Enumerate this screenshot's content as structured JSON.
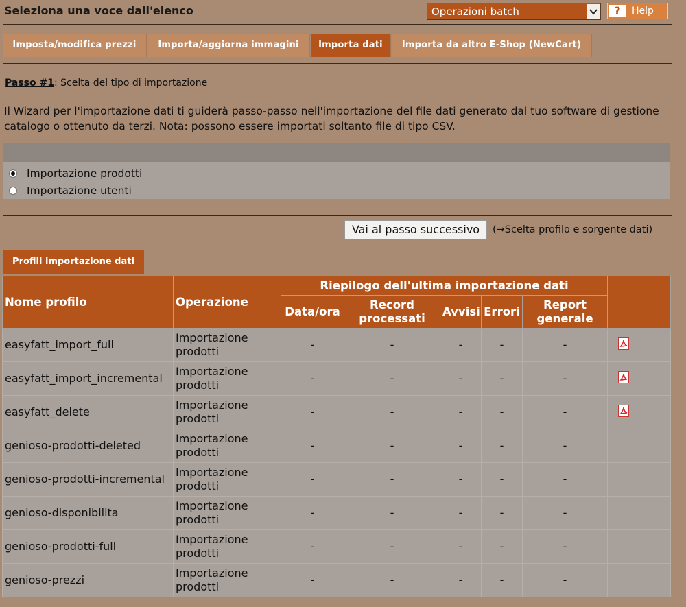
{
  "header": {
    "title": "Seleziona una voce dall'elenco",
    "batch_select": "Operazioni batch",
    "help": "Help",
    "help_glyph": "?"
  },
  "tabs": [
    {
      "label": "Imposta/modifica prezzi",
      "active": false
    },
    {
      "label": "Importa/aggiorna immagini",
      "active": false
    },
    {
      "label": "Importa dati",
      "active": true
    },
    {
      "label": "Importa da altro E-Shop (NewCart)",
      "active": false
    }
  ],
  "step": {
    "label": "Passo #1",
    "text": ": Scelta del tipo di importazione"
  },
  "intro": "Il Wizard per l'importazione dati ti guiderà passo-passo nell'importazione del file dati generato dal tuo software di gestione catalogo o ottenuto da terzi. Nota: possono essere importati soltanto file di tipo CSV.",
  "options": [
    {
      "label": "Importazione prodotti",
      "checked": true
    },
    {
      "label": "Importazione utenti",
      "checked": false
    }
  ],
  "next": {
    "button": "Vai al passo successivo",
    "hint": "(→Scelta profilo e sorgente dati)"
  },
  "profiles_tab": "Profili importazione dati",
  "table": {
    "headers": {
      "name": "Nome profilo",
      "operation": "Operazione",
      "summary": "Riepilogo dell'ultima importazione dati",
      "datetime": "Data/ora",
      "records": "Record processati",
      "warnings": "Avvisi",
      "errors": "Errori",
      "report": "Report generale"
    },
    "rows": [
      {
        "name": "easyfatt_import_full",
        "operation": "Importazione prodotti",
        "datetime": "-",
        "records": "-",
        "warnings": "-",
        "errors": "-",
        "report": "-",
        "pdf": true
      },
      {
        "name": "easyfatt_import_incremental",
        "operation": "Importazione prodotti",
        "datetime": "-",
        "records": "-",
        "warnings": "-",
        "errors": "-",
        "report": "-",
        "pdf": true
      },
      {
        "name": "easyfatt_delete",
        "operation": "Importazione prodotti",
        "datetime": "-",
        "records": "-",
        "warnings": "-",
        "errors": "-",
        "report": "-",
        "pdf": true
      },
      {
        "name": "genioso-prodotti-deleted",
        "operation": "Importazione prodotti",
        "datetime": "-",
        "records": "-",
        "warnings": "-",
        "errors": "-",
        "report": "-",
        "pdf": false
      },
      {
        "name": "genioso-prodotti-incremental",
        "operation": "Importazione prodotti",
        "datetime": "-",
        "records": "-",
        "warnings": "-",
        "errors": "-",
        "report": "-",
        "pdf": false
      },
      {
        "name": "genioso-disponibilita",
        "operation": "Importazione prodotti",
        "datetime": "-",
        "records": "-",
        "warnings": "-",
        "errors": "-",
        "report": "-",
        "pdf": false
      },
      {
        "name": "genioso-prodotti-full",
        "operation": "Importazione prodotti",
        "datetime": "-",
        "records": "-",
        "warnings": "-",
        "errors": "-",
        "report": "-",
        "pdf": false
      },
      {
        "name": "genioso-prezzi",
        "operation": "Importazione prodotti",
        "datetime": "-",
        "records": "-",
        "warnings": "-",
        "errors": "-",
        "report": "-",
        "pdf": false
      }
    ]
  },
  "colors": {
    "accent": "#b5541a",
    "tab": "#c08a63",
    "background": "#a98a72",
    "panel": "#a8a09a"
  }
}
